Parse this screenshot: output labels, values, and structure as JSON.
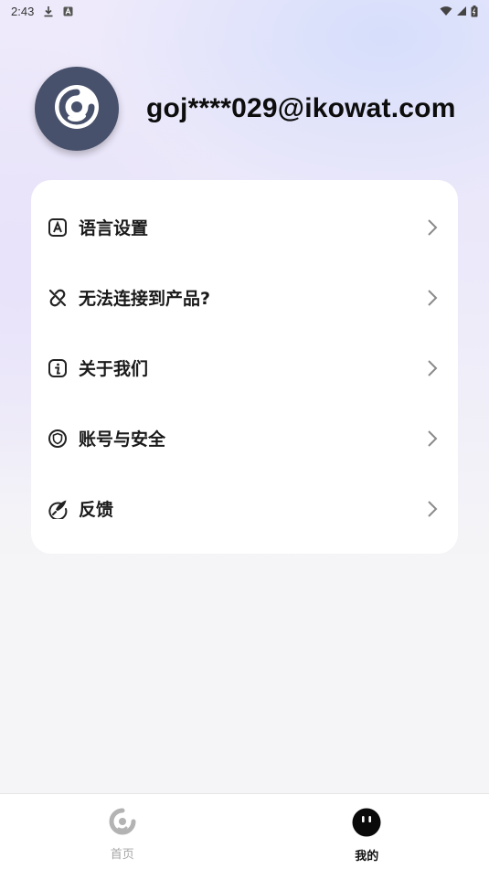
{
  "status_bar": {
    "time": "2:43",
    "icons": [
      "download-icon",
      "a-badge-icon",
      "wifi-icon",
      "signal-icon",
      "battery-icon"
    ]
  },
  "profile": {
    "email": "goj****029@ikowat.com",
    "avatar_icon": "app-logo-icon"
  },
  "menu": {
    "items": [
      {
        "label": "语言设置",
        "icon": "language-icon"
      },
      {
        "label": "无法连接到产品?",
        "icon": "broken-link-icon"
      },
      {
        "label": "关于我们",
        "icon": "info-icon"
      },
      {
        "label": "账号与安全",
        "icon": "shield-icon"
      },
      {
        "label": "反馈",
        "icon": "feedback-pen-icon"
      }
    ]
  },
  "bottom_nav": {
    "tabs": [
      {
        "label": "首页",
        "icon": "home-logo-icon",
        "active": false
      },
      {
        "label": "我的",
        "icon": "profile-face-icon",
        "active": true
      }
    ]
  },
  "colors": {
    "avatar_bg": "#48516b",
    "card_bg": "#ffffff",
    "inactive_tab": "#a6a6a6",
    "active_tab": "#111111"
  }
}
